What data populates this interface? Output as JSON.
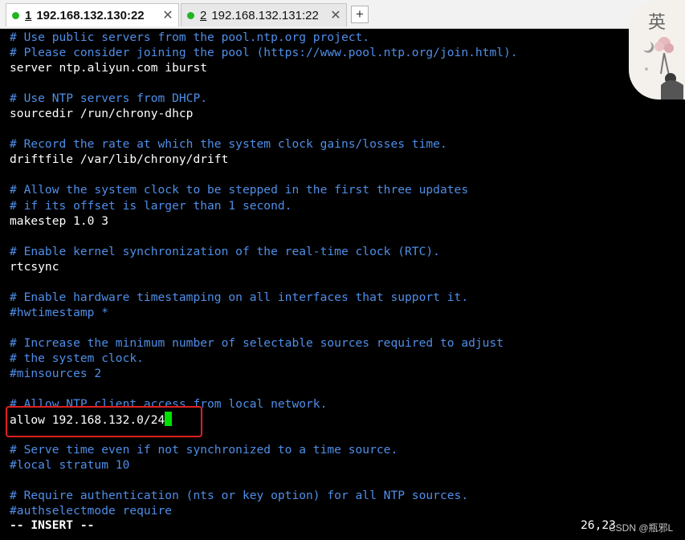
{
  "tabs": [
    {
      "number": "1",
      "host": "192.168.132.130:22",
      "active": true
    },
    {
      "number": "2",
      "host": "192.168.132.131:22",
      "active": false
    }
  ],
  "tab_close": "✕",
  "new_tab": "+",
  "avatar": {
    "char": "英"
  },
  "terminal": {
    "lines": [
      {
        "type": "comment",
        "text": "# Use public servers from the pool.ntp.org project."
      },
      {
        "type": "comment",
        "text": "# Please consider joining the pool (https://www.pool.ntp.org/join.html)."
      },
      {
        "type": "code",
        "text": "server ntp.aliyun.com iburst"
      },
      {
        "type": "blank",
        "text": ""
      },
      {
        "type": "comment",
        "text": "# Use NTP servers from DHCP."
      },
      {
        "type": "code",
        "text": "sourcedir /run/chrony-dhcp"
      },
      {
        "type": "blank",
        "text": ""
      },
      {
        "type": "comment",
        "text": "# Record the rate at which the system clock gains/losses time."
      },
      {
        "type": "code",
        "text": "driftfile /var/lib/chrony/drift"
      },
      {
        "type": "blank",
        "text": ""
      },
      {
        "type": "comment",
        "text": "# Allow the system clock to be stepped in the first three updates"
      },
      {
        "type": "comment",
        "text": "# if its offset is larger than 1 second."
      },
      {
        "type": "code",
        "text": "makestep 1.0 3"
      },
      {
        "type": "blank",
        "text": ""
      },
      {
        "type": "comment",
        "text": "# Enable kernel synchronization of the real-time clock (RTC)."
      },
      {
        "type": "code",
        "text": "rtcsync"
      },
      {
        "type": "blank",
        "text": ""
      },
      {
        "type": "comment",
        "text": "# Enable hardware timestamping on all interfaces that support it."
      },
      {
        "type": "comment",
        "text": "#hwtimestamp *"
      },
      {
        "type": "blank",
        "text": ""
      },
      {
        "type": "comment",
        "text": "# Increase the minimum number of selectable sources required to adjust"
      },
      {
        "type": "comment",
        "text": "# the system clock."
      },
      {
        "type": "comment",
        "text": "#minsources 2"
      },
      {
        "type": "blank",
        "text": ""
      },
      {
        "type": "comment",
        "text": "# Allow NTP client access from local network."
      },
      {
        "type": "code",
        "text": "allow 192.168.132.0/24",
        "cursor": true
      },
      {
        "type": "blank",
        "text": ""
      },
      {
        "type": "comment",
        "text": "# Serve time even if not synchronized to a time source."
      },
      {
        "type": "comment",
        "text": "#local stratum 10"
      },
      {
        "type": "blank",
        "text": ""
      },
      {
        "type": "comment",
        "text": "# Require authentication (nts or key option) for all NTP sources."
      },
      {
        "type": "comment",
        "text": "#authselectmode require"
      }
    ]
  },
  "status": {
    "mode": "-- INSERT --",
    "position": "26,23"
  },
  "watermark": "CSDN @瓶邪L",
  "colors": {
    "comment": "#4f8ee8",
    "cursor": "#00e000",
    "highlight_box": "#e02020",
    "active_dot": "#22b422"
  }
}
